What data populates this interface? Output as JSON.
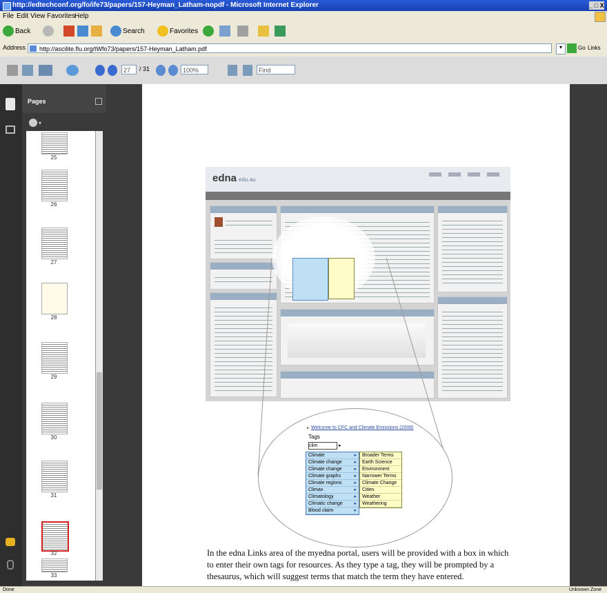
{
  "window": {
    "title": "http://edtechconf.org/fo/ife73/papers/157-Heyman_Latham-nopdf - Microsoft Internet Explorer",
    "controls_label": "_ □ X"
  },
  "menubar": {
    "items": [
      "File",
      "Edit",
      "View",
      "Favorites",
      "Help"
    ]
  },
  "toolbar": {
    "back": "Back",
    "search": "Search",
    "favorites": "Favorites"
  },
  "addressbar": {
    "label": "Address",
    "url": "http://ascilite.flu.org/tWfo73/papers/157-Heyman_Latham.pdf",
    "go": "Go",
    "links": "Links"
  },
  "reader": {
    "page_field": "27",
    "page_total": "/ 31",
    "zoom": "100%",
    "find_placeholder": "Find"
  },
  "sidebar": {
    "panel_title": "Pages",
    "thumb_labels": [
      "25",
      "26",
      "27",
      "28",
      "29",
      "30",
      "31",
      "32",
      "33"
    ],
    "selected_thumb": "32"
  },
  "document": {
    "shot": {
      "logo": "edna",
      "logo_suffix": "edu.au"
    },
    "zoom_inset": {
      "link_text": "Welcome to CFC and Climate Emissions (2008)",
      "tags_caption": "Tags",
      "input_value": "clim",
      "menu1": [
        "Climate",
        "Climate change",
        "Climate change",
        "Climate graphs",
        "Climate regions",
        "Climax",
        "Climatology",
        "Climatic change",
        "Blood claim"
      ],
      "menu2": [
        "Broader Terms",
        "Earth Science",
        "Environment",
        "Narrower Terms",
        "Climate Change",
        "Cities",
        "Weather",
        "Weathering"
      ]
    },
    "body_text": "In the edna Links area of the myedna portal, users will be provided with a box in which to enter their own tags for resources. As they type a tag, they will be prompted by a thesaurus, which will suggest terms that match the term they have entered."
  },
  "statusbar": {
    "left": "Done",
    "zone": "Unknown Zone"
  }
}
